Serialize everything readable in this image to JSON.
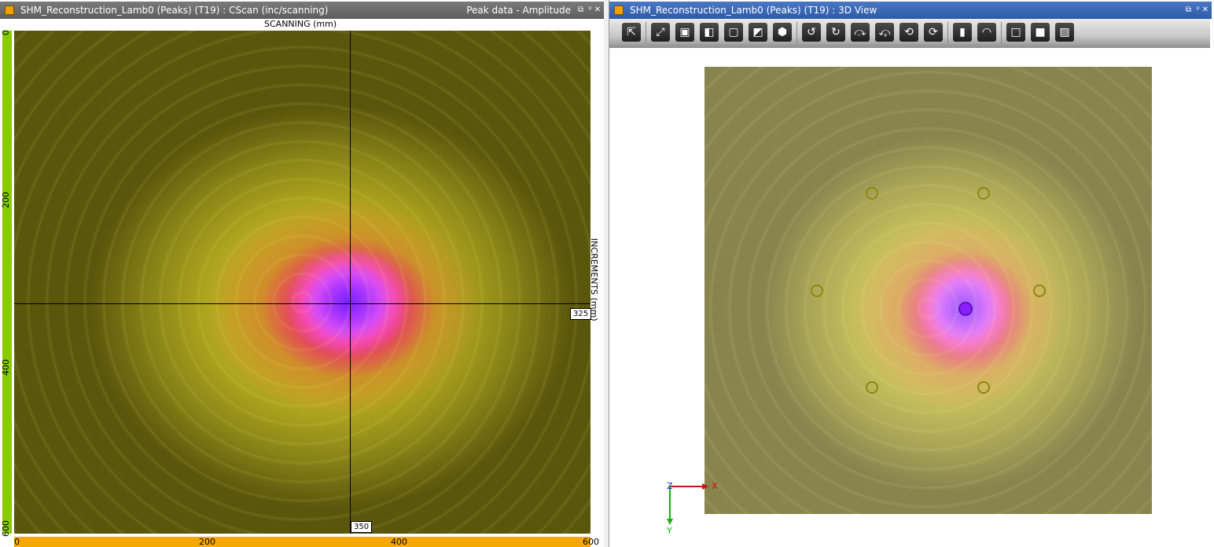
{
  "left_panel": {
    "title": "SHM_Reconstruction_Lamb0 (Peaks) (T19) : CScan (inc/scanning)",
    "subtitle": "Peak data - Amplitude",
    "x_axis_label": "SCANNING (mm)",
    "y_axis_label": "INCREMENTS (mm)",
    "x_ticks": [
      "0",
      "200",
      "400",
      "600"
    ],
    "y_ticks": [
      "0",
      "200",
      "400",
      "600"
    ],
    "cursor_x_value": "350",
    "cursor_y_value": "325"
  },
  "right_panel": {
    "title": "SHM_Reconstruction_Lamb0 (Peaks) (T19) : 3D View",
    "axis_x": "X",
    "axis_y": "Y",
    "axis_z": "Z",
    "toolbar_icons": [
      "select-icon",
      "fit-icon",
      "cube-view-icon",
      "cube-red-icon",
      "wire-cube-icon",
      "cube-red-face-icon",
      "cube-iso-icon",
      "rotate-left-icon",
      "rotate-right-icon",
      "rotate-up-icon",
      "rotate-down-icon",
      "rotate-ccw-icon",
      "rotate-cw-icon",
      "ruler-icon",
      "protractor-icon",
      "box-outline-icon",
      "box-solid-icon",
      "hatch-icon"
    ]
  },
  "colors": {
    "accent_orange": "#f5a800",
    "axis_green": "#88cc00",
    "active_title": "#2e5aa8"
  }
}
